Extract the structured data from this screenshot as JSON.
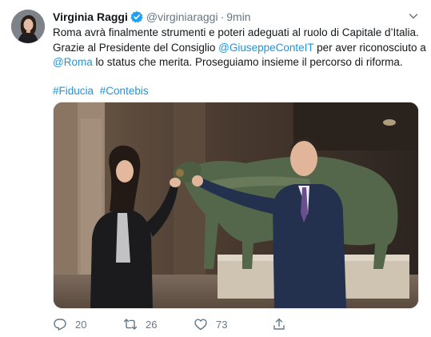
{
  "tweet": {
    "author_name": "Virginia Raggi",
    "author_handle": "@virginiaraggi",
    "separator": "·",
    "time": "9min",
    "lines": {
      "l1": "Roma avrà finalmente strumenti e poteri adeguati al ruolo di Capitale d’Italia.",
      "l2_pre": "Grazie al Presidente del Consiglio ",
      "l2_mention": "@GiuseppeConteIT",
      "l2_post": " per aver riconosciuto a",
      "l3_mention": "@Roma",
      "l3_post": " lo status che merita. Proseguiamo insieme il percorso di riforma."
    },
    "hashtags": [
      "#Fiducia",
      "#Contebis"
    ]
  },
  "actions": {
    "replies": "20",
    "retweets": "26",
    "likes": "73"
  },
  "colors": {
    "link": "#1b95e0",
    "muted": "#657786",
    "verified": "#1da1f2"
  },
  "icons": [
    "verified-badge-icon",
    "chevron-down-icon",
    "reply-icon",
    "retweet-icon",
    "like-icon",
    "share-icon"
  ]
}
